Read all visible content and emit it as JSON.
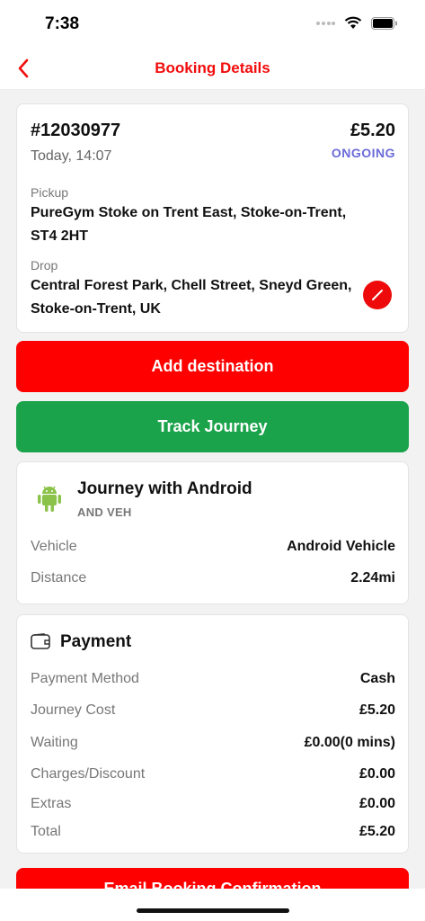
{
  "status_bar": {
    "time": "7:38"
  },
  "nav": {
    "title": "Booking Details"
  },
  "booking": {
    "id": "#12030977",
    "date": "Today, 14:07",
    "price": "£5.20",
    "status": "ONGOING",
    "pickup_label": "Pickup",
    "pickup_address": "PureGym Stoke on Trent East, Stoke-on-Trent, ST4 2HT",
    "drop_label": "Drop",
    "drop_address": "Central Forest Park, Chell Street, Sneyd Green, Stoke-on-Trent, UK"
  },
  "buttons": {
    "add_destination": "Add destination",
    "track_journey": "Track Journey",
    "email_confirmation": "Email Booking Confirmation"
  },
  "journey": {
    "title": "Journey with Android",
    "subtitle": "AND VEH",
    "vehicle_label": "Vehicle",
    "vehicle_value": "Android Vehicle",
    "distance_label": "Distance",
    "distance_value": "2.24mi"
  },
  "payment": {
    "title": "Payment",
    "rows": [
      {
        "label": "Payment Method",
        "value": "Cash"
      },
      {
        "label": "Journey Cost",
        "value": "£5.20"
      },
      {
        "label": "Waiting",
        "value": "£0.00(0 mins)"
      },
      {
        "label": "Charges/Discount",
        "value": "£0.00"
      },
      {
        "label": "Extras",
        "value": "£0.00"
      },
      {
        "label": "Total",
        "value": "£5.20"
      }
    ]
  },
  "colors": {
    "accent_red": "#fe0000",
    "green": "#1aa34a",
    "status_purple": "#6b6bd9",
    "android_green": "#8bc34a"
  }
}
